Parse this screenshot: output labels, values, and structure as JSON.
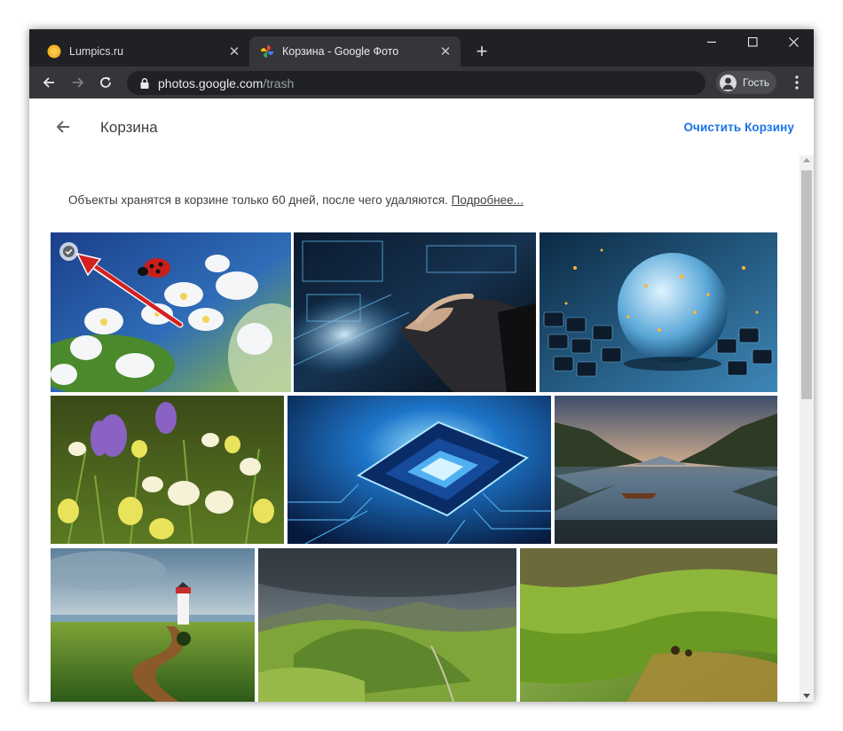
{
  "browser": {
    "tabs": [
      {
        "title": "Lumpics.ru",
        "active": false,
        "favicon": "orange-circle-favicon"
      },
      {
        "title": "Корзина - Google Фото",
        "active": true,
        "favicon": "google-photos-pinwheel-favicon"
      }
    ],
    "new_tab_icon": "plus-icon",
    "address": {
      "host": "photos.google.com",
      "path": "/trash"
    },
    "profile_label": "Гость"
  },
  "page": {
    "title": "Корзина",
    "empty_trash_label": "Очистить Корзину",
    "info_text": "Объекты хранятся в корзине только 60 дней, после чего удаляются.",
    "info_link": "Подробнее..."
  },
  "photos": [
    {
      "subject": "ladybug-on-white-blossoms",
      "selected": true
    },
    {
      "subject": "hand-on-holographic-keyboard",
      "selected": false
    },
    {
      "subject": "glowing-globe-on-keyboard",
      "selected": false
    },
    {
      "subject": "crocuses-purple-white",
      "selected": false
    },
    {
      "subject": "blue-microchip",
      "selected": false
    },
    {
      "subject": "lake-with-boat-mountains",
      "selected": false
    },
    {
      "subject": "lighthouse-green-field",
      "selected": false
    },
    {
      "subject": "green-valley-mountains",
      "selected": false
    },
    {
      "subject": "rolling-green-hills",
      "selected": false
    }
  ],
  "colors": {
    "accent": "#1a73e8",
    "titlebar": "#202124",
    "toolbar": "#35363a",
    "annotation_arrow": "#d32020"
  }
}
